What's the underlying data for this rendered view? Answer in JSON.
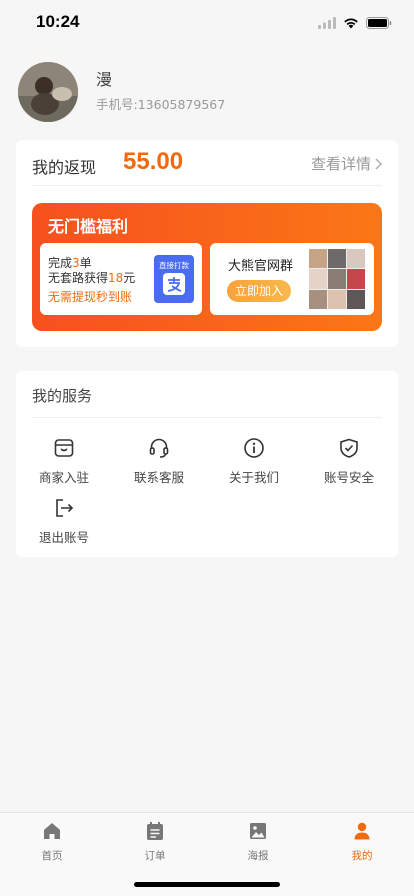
{
  "status_bar": {
    "time": "10:24"
  },
  "profile": {
    "username": "漫",
    "phone": "手机号:13605879567"
  },
  "cashback": {
    "label": "我的返现",
    "amount": "55.00",
    "detail_link": "查看详情"
  },
  "welfare": {
    "title": "无门槛福利",
    "left_box": {
      "line1_a": "完成",
      "line1_num": "3",
      "line1_b": "单",
      "line2_a": "无套路获得",
      "line2_num": "18",
      "line2_b": "元",
      "line3": "无需提现秒到账",
      "alipay_label": "直接打款"
    },
    "right_box": {
      "group_name": "大熊官网群",
      "join_button": "立即加入"
    }
  },
  "services": {
    "title": "我的服务",
    "items": [
      {
        "label": "商家入驻",
        "icon": "store-icon"
      },
      {
        "label": "联系客服",
        "icon": "headset-icon"
      },
      {
        "label": "关于我们",
        "icon": "info-icon"
      },
      {
        "label": "账号安全",
        "icon": "shield-check-icon"
      },
      {
        "label": "退出账号",
        "icon": "logout-icon"
      }
    ]
  },
  "tabbar": {
    "tabs": [
      {
        "label": "首页",
        "icon": "home-icon"
      },
      {
        "label": "订单",
        "icon": "orders-icon"
      },
      {
        "label": "海报",
        "icon": "poster-icon"
      },
      {
        "label": "我的",
        "icon": "user-icon",
        "active": true
      }
    ]
  },
  "colors": {
    "accent": "#f26a10",
    "welfare_start": "#f6501e",
    "welfare_end": "#fb7716",
    "alipay": "#4a6cf0"
  }
}
